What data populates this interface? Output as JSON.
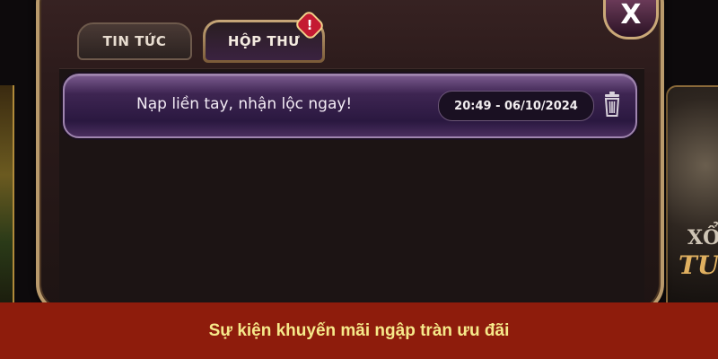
{
  "tabs": [
    {
      "label": "TIN TỨC",
      "active": false
    },
    {
      "label": "HỘP THƯ",
      "active": true
    }
  ],
  "inbox_alert": "!",
  "close_label": "X",
  "messages": [
    {
      "title": "Nạp liền tay, nhận lộc ngay!",
      "time": "20:49 - 06/10/2024"
    }
  ],
  "background_card": {
    "line1": "XỔ",
    "line2": "TU"
  },
  "banner": {
    "text": "Sự kiện khuyến mãi ngập tràn ưu đãi",
    "background": "#8e1c0c",
    "color": "#f6e98a"
  },
  "icons": {
    "trash": "trash-icon",
    "close": "close-icon",
    "alert": "alert-icon"
  }
}
